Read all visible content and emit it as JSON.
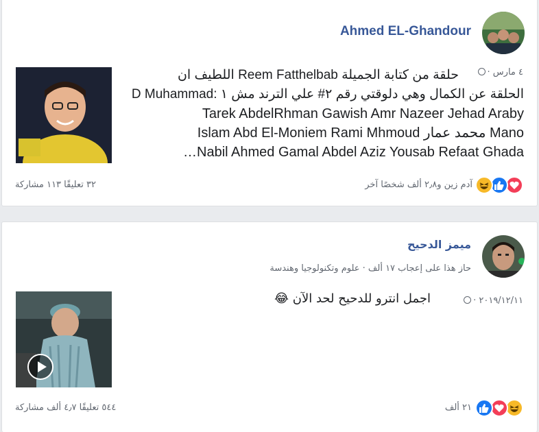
{
  "post1": {
    "author": "Ahmed EL-Ghandour",
    "meta": "٤ مارس ·",
    "lines": [
      "حلقة من كتابة الجميلة Reem Fatthelbab اللطيف ان",
      "الحلقة عن الكمال وهي دلوقتي رقم ٢# علي الترند مش ١ :D Muhammad",
      "Tarek AbdelRhman Gawish Amr Nazeer Jehad Araby",
      "Mano محمد عمار Islam Abd El-Moniem Rami Mhmoud",
      "Nabil Ahmed Gamal Abdel Aziz Yousab Refaat Ghada…"
    ],
    "reactors": "آدم زين و٢٫٨ ألف شخصًا آخر",
    "counts": "٣٢ تعليقًا  ١١٣ مشاركة"
  },
  "post2": {
    "author": "ميمز الدحيح",
    "subtitle": "حاز هذا على إعجاب ١٧ ألف · علوم وتكنولوجيا وهندسة",
    "meta": "٢٠١٩/١٢/١١ ·",
    "text": "اجمل انترو للدحيح لحد الآن",
    "emoji": "😂",
    "reactions_count": "٢١ ألف",
    "counts": "٥٤٤ تعليقًا  ٤٫٧ ألف مشاركة"
  },
  "colors": {
    "name": "#385898",
    "like": "#1877f2",
    "love": "#f33e58",
    "haha": "#f7b928"
  },
  "icons": [
    "globe-icon",
    "like-reaction-icon",
    "love-reaction-icon",
    "haha-reaction-icon",
    "play-icon"
  ]
}
